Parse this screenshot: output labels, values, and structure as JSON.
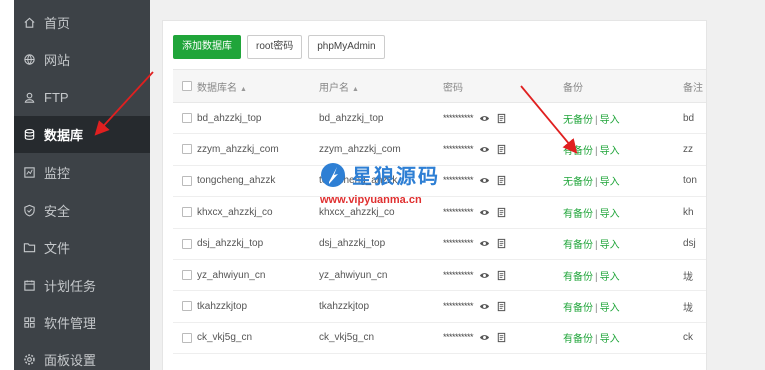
{
  "sidebar": {
    "items": [
      {
        "label": "首页",
        "icon": "home-icon"
      },
      {
        "label": "网站",
        "icon": "globe-icon"
      },
      {
        "label": "FTP",
        "icon": "ftp-user-icon"
      },
      {
        "label": "数据库",
        "icon": "database-icon",
        "active": true
      },
      {
        "label": "监控",
        "icon": "monitor-icon"
      },
      {
        "label": "安全",
        "icon": "shield-icon"
      },
      {
        "label": "文件",
        "icon": "folder-icon"
      },
      {
        "label": "计划任务",
        "icon": "calendar-icon"
      },
      {
        "label": "软件管理",
        "icon": "apps-grid-icon"
      },
      {
        "label": "面板设置",
        "icon": "gear-icon"
      }
    ]
  },
  "toolbar": {
    "add_db": "添加数据库",
    "root_pwd": "root密码",
    "phpmyadmin": "phpMyAdmin"
  },
  "table": {
    "headers": {
      "name": "数据库名",
      "user": "用户名",
      "pwd": "密码",
      "backup": "备份",
      "note": "备注"
    },
    "sort_glyph": "▲",
    "rows": [
      {
        "name": "bd_ahzzkj_top",
        "user": "bd_ahzzkj_top",
        "pwd": "**********",
        "backup": "无备份",
        "import": "导入",
        "note": "bd"
      },
      {
        "name": "zzym_ahzzkj_com",
        "user": "zzym_ahzzkj_com",
        "pwd": "**********",
        "backup": "有备份",
        "import": "导入",
        "note": "zz"
      },
      {
        "name": "tongcheng_ahzzk",
        "user": "tongcheng_ahzzk",
        "pwd": "**********",
        "backup": "无备份",
        "import": "导入",
        "note": "ton"
      },
      {
        "name": "khxcx_ahzzkj_co",
        "user": "khxcx_ahzzkj_co",
        "pwd": "**********",
        "backup": "有备份",
        "import": "导入",
        "note": "kh"
      },
      {
        "name": "dsj_ahzzkj_top",
        "user": "dsj_ahzzkj_top",
        "pwd": "**********",
        "backup": "有备份",
        "import": "导入",
        "note": "dsj"
      },
      {
        "name": "yz_ahwiyun_cn",
        "user": "yz_ahwiyun_cn",
        "pwd": "**********",
        "backup": "有备份",
        "import": "导入",
        "note": "垅"
      },
      {
        "name": "tkahzzkjtop",
        "user": "tkahzzkjtop",
        "pwd": "**********",
        "backup": "有备份",
        "import": "导入",
        "note": "垅"
      },
      {
        "name": "ck_vkj5g_cn",
        "user": "ck_vkj5g_cn",
        "pwd": "**********",
        "backup": "有备份",
        "import": "导入",
        "note": "ck"
      }
    ]
  },
  "watermark": {
    "title": "星狼源码",
    "url": "www.vipyuanma.cn"
  },
  "colors": {
    "sidebar_bg": "#3d4247",
    "sidebar_active_bg": "#262a2e",
    "accent_green": "#20a53a",
    "annotation_red": "#e02020"
  }
}
